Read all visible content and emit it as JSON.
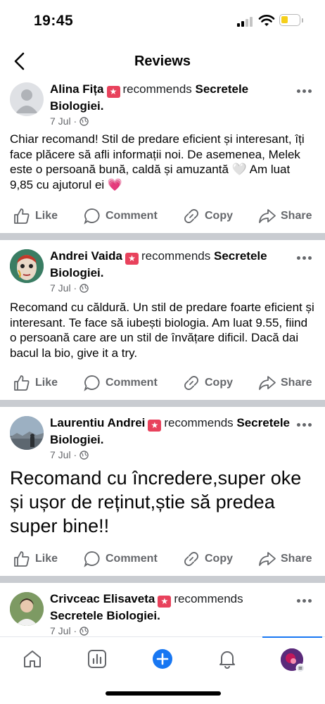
{
  "status": {
    "time": "19:45"
  },
  "nav": {
    "title": "Reviews"
  },
  "posts": [
    {
      "name": "Alina Fița",
      "recommends": "recommends",
      "page": "Secretele Biologiei.",
      "date": "7 Jul",
      "text": "Chiar recomand! Stil de predare eficient și interesant, îți face plăcere să afli informații noi. De asemenea, Melek este o persoană bună, caldă și amuzantă 🤍 Am luat 9,85 cu ajutorul ei 💗"
    },
    {
      "name": "Andrei Vaida",
      "recommends": "recommends",
      "page": "Secretele Biologiei.",
      "date": "7 Jul",
      "text": "Recomand cu căldură. Un stil de predare foarte eficient și interesant. Te face să iubești biologia. Am luat 9.55, fiind o persoană care are un stil de învățare dificil. Dacă dai bacul la bio, give it a try."
    },
    {
      "name": "Laurentiu Andrei",
      "recommends": "recommends",
      "page": "Secretele Biologiei.",
      "date": "7 Jul",
      "text": "Recomand cu încredere,super oke și ușor de reținut,știe să predea super bine!!"
    },
    {
      "name": "Crivceac Elisaveta",
      "recommends": "recommends",
      "page": "Secretele Biologiei.",
      "date": "7 Jul"
    }
  ],
  "actions": {
    "like": "Like",
    "comment": "Comment",
    "copy": "Copy",
    "share": "Share"
  },
  "tabs": [
    "home-icon",
    "dashboard-icon",
    "create-icon",
    "notifications-icon",
    "profile-icon"
  ],
  "colors": {
    "accent": "#1877f2",
    "badge": "#e8425c",
    "meta": "#65676b"
  }
}
